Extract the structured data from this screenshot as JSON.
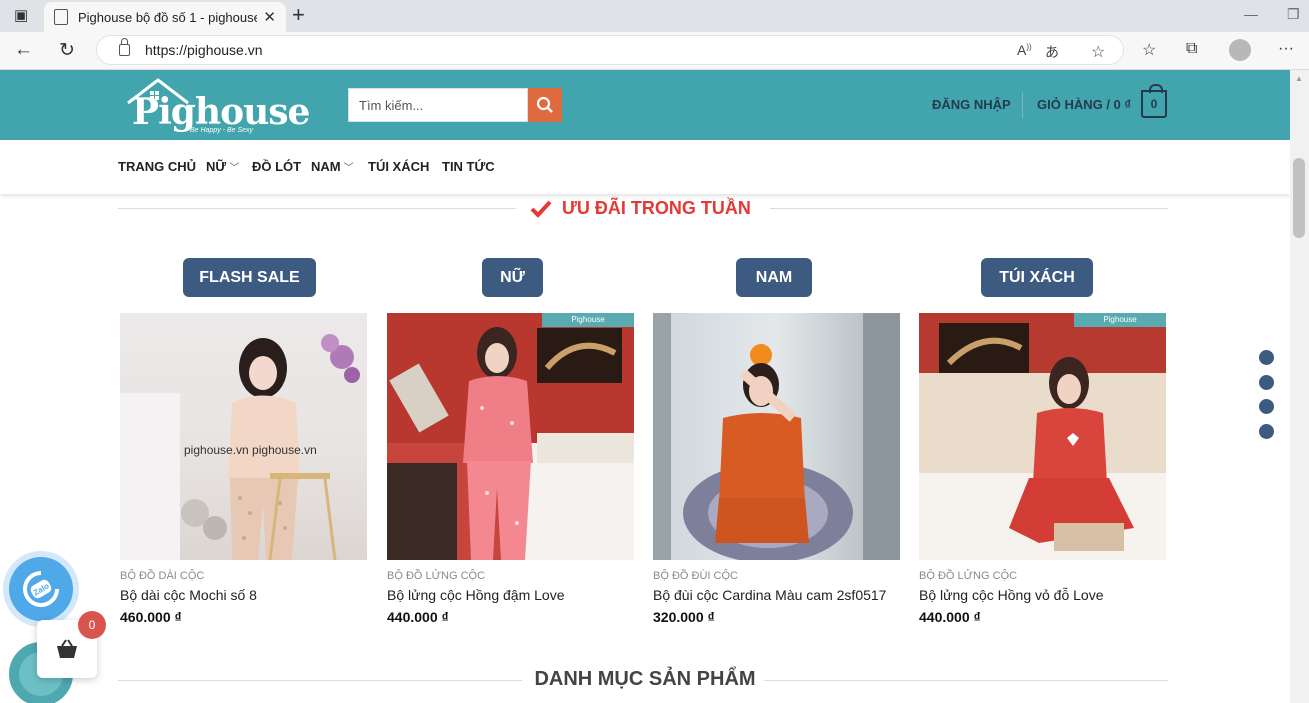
{
  "browser": {
    "tab_title": "Pighouse bộ đồ số 1 - pighouse.",
    "url": "https://pighouse.vn"
  },
  "header": {
    "logo_text": "Pighouse",
    "logo_tagline": "Be Happy - Be Sexy",
    "search_placeholder": "Tìm kiếm...",
    "login_label": "ĐĂNG NHẬP",
    "cart_label": "GIỎ HÀNG / 0 ₫",
    "cart_count": "0"
  },
  "menu": {
    "items": [
      {
        "label": "TRANG CHỦ",
        "dropdown": false
      },
      {
        "label": "NỮ",
        "dropdown": true
      },
      {
        "label": "ĐỒ LÓT",
        "dropdown": false
      },
      {
        "label": "NAM",
        "dropdown": true
      },
      {
        "label": "TÚI XÁCH",
        "dropdown": false
      },
      {
        "label": "TIN TỨC",
        "dropdown": false
      }
    ]
  },
  "section": {
    "title": "ƯU ĐÃI TRONG TUẦN",
    "accent_color": "#e53935"
  },
  "category_buttons": [
    "FLASH SALE",
    "NỮ",
    "NAM",
    "TÚI XÁCH"
  ],
  "products": [
    {
      "category": "BỘ ĐỒ DÀI CỘC",
      "name": "Bộ dài cộc Mochi số 8",
      "price": "460.000 ₫",
      "watermark": "pighouse.vn  pighouse.vn",
      "stamp": ""
    },
    {
      "category": "BỘ ĐỒ LỬNG CỘC",
      "name": "Bộ lửng cộc Hồng đậm Love",
      "price": "440.000 ₫",
      "watermark": "",
      "stamp": "Pighouse"
    },
    {
      "category": "BỘ ĐỒ ĐÙI CỘC",
      "name": "Bộ đùi cộc Cardina Màu cam 2sf0517",
      "price": "320.000 ₫",
      "watermark": "",
      "stamp": ""
    },
    {
      "category": "BỘ ĐỒ LỬNG CỘC",
      "name": "Bộ lửng cộc Hồng vỏ đỗ Love",
      "price": "440.000 ₫",
      "watermark": "",
      "stamp": "Pighouse"
    }
  ],
  "bottom_section": {
    "title": "DANH MỤC SẢN PHẨM"
  },
  "floating": {
    "zalo_label": "Zalo",
    "basket_count": "0"
  },
  "colors": {
    "header_bg": "#42a5ad",
    "button_bg": "#3d5a80",
    "search_btn": "#e06a3f"
  }
}
